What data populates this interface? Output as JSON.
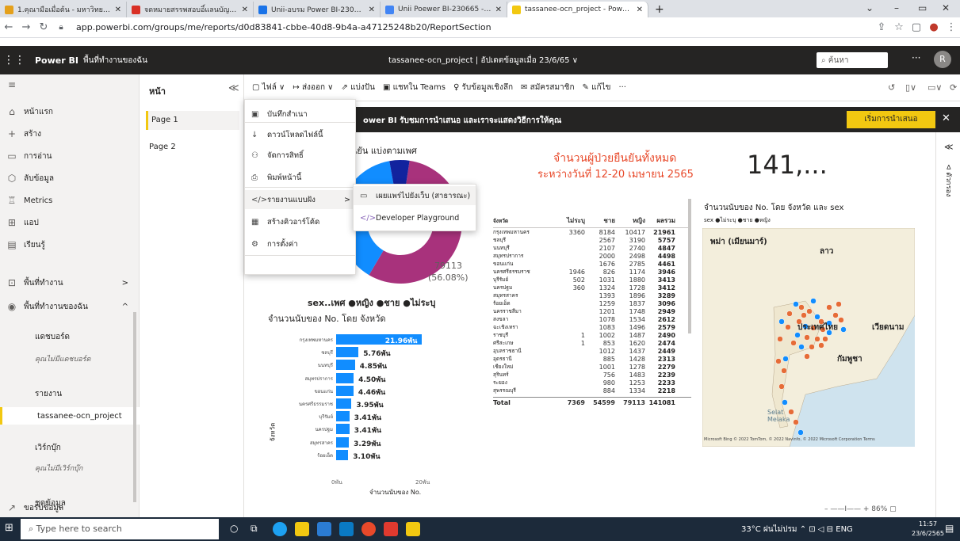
{
  "tabs": [
    {
      "title": "1.คุณามือเมื่อต้น - มหาวิทยาลัยอุบ",
      "color": "#e4a01b"
    },
    {
      "title": "จดหมายสรรพสอบอิ์แลนบัญชี Ubon R",
      "color": "#d93025"
    },
    {
      "title": "Unii-อบรม Power BI-2306665 - G",
      "color": "#1a73e8"
    },
    {
      "title": "Unii Poewer BI-230665 - Google",
      "color": "#4285f4"
    },
    {
      "title": "tassanee-ocn_project - Power BI",
      "color": "#f2c811"
    }
  ],
  "url": "app.powerbi.com/groups/me/reports/d0d83841-cbbe-40d8-9b4a-a47125248b20/ReportSection",
  "header": {
    "app": "Power BI",
    "workspace": "พื้นที่ทำงานของฉัน",
    "report": "tassanee-ocn_project",
    "updated": "อัปเดตข้อมูลเมื่อ 23/6/65",
    "search": "ค้นหา",
    "user_initial": "R"
  },
  "leftnav": [
    {
      "icon": "⌂",
      "label": "หน้าแรก"
    },
    {
      "icon": "+",
      "label": "สร้าง"
    },
    {
      "icon": "▭",
      "label": "การอ่าน"
    },
    {
      "icon": "⬡",
      "label": "ลับข้อมูล"
    },
    {
      "icon": "♖",
      "label": "Metrics"
    },
    {
      "icon": "⊞",
      "label": "แอป"
    },
    {
      "icon": "▤",
      "label": "เรียนรู้"
    },
    {
      "icon": "⊡",
      "label": "พื้นที่ทำงาน"
    },
    {
      "icon": "◉",
      "label": "พื้นที่ทำงานของฉัน"
    }
  ],
  "leftsub": [
    "แดชบอร์ด",
    "คุณไม่มีแดชบอร์ด",
    "รายงาน",
    "tassanee-ocn_project",
    "เวิร์กบุ๊ก",
    "คุณไม่มีเวิร์กบุ๊ก",
    "ชุดข้อมูล"
  ],
  "getdata": "ขอรับข้อมูล",
  "pages_title": "หน้า",
  "pages": [
    "Page 1",
    "Page 2"
  ],
  "toolbar": [
    "ไฟล์ ∨",
    "ส่งออก ∨",
    "แบ่งปัน",
    "แชทใน Teams",
    "รับข้อมูลเชิงลึก",
    "สมัครสมาชิก",
    "แก้ไข",
    "···"
  ],
  "banner": {
    "text": "ower BI  รับชมการนำเสนอ และเราจะแสดงวิธีการให้คุณ",
    "button": "เริ่มการนำเสนอ"
  },
  "menu_file": [
    "บันทึกสำเนา",
    "ดาวน์โหลดไฟล์นี้",
    "จัดการสิทธิ์",
    "พิมพ์หน้านี้",
    "รายงานแบบฝัง",
    "สร้างคิวอาร์โค้ด",
    "การตั้งค่า"
  ],
  "menu_embed": [
    "เผยแพร่ไปยังเว็บ (สาธารณะ)",
    "Developer Playground"
  ],
  "report": {
    "donut_title": "ยยืนยัน แบ่งตามเพศ",
    "donut_label": "79113",
    "donut_pct": "(56.08%)",
    "legend": "sex..เพศ ●หญิง ●ชาย ●ไม่ระบุ",
    "headline_1": "จำนวนผู้ป่วยยืนยันทั้งหมด",
    "headline_2": "ระหว่างวันที่ 12-20 เมษายน 2565",
    "kpi": "141,...",
    "bar_title": "จำนวนนับของ No. โดย จังหวัด",
    "bar_ylabel": "จังหวัด",
    "bar_xlabel": "จำนวนนับของ No.",
    "bar_ticks": [
      "0พัน",
      "20พัน"
    ],
    "map_title": "จำนวนนับของ No. โดย จังหวัด และ sex",
    "map_legend": "sex ●ไม่ระบุ ●ชาย ●หญิง",
    "map_labels": [
      "พม่า (เมียนมาร์)",
      "ลาว",
      "ประเทศไทย",
      "เวียดนาม",
      "กัมพูชา",
      "Selat Melaka"
    ],
    "map_credit": "Microsoft Bing © 2022 TomTom, © 2022 Navinfo, © 2022 Microsoft Corporation  Terms"
  },
  "table": {
    "headers": [
      "จังหวัด",
      "ไม่ระบุ",
      "ชาย",
      "หญิง",
      "ผลรวม"
    ],
    "rows": [
      [
        "กรุงเทพมหานคร",
        "3360",
        "8184",
        "10417",
        "21961"
      ],
      [
        "ชลบุรี",
        "",
        "2567",
        "3190",
        "5757"
      ],
      [
        "นนทบุรี",
        "",
        "2107",
        "2740",
        "4847"
      ],
      [
        "สมุทรปราการ",
        "",
        "2000",
        "2498",
        "4498"
      ],
      [
        "ขอนแก่น",
        "",
        "1676",
        "2785",
        "4461"
      ],
      [
        "นครศรีธรรมราช",
        "1946",
        "826",
        "1174",
        "3946"
      ],
      [
        "บุรีรัมย์",
        "502",
        "1031",
        "1880",
        "3413"
      ],
      [
        "นครปฐม",
        "360",
        "1324",
        "1728",
        "3412"
      ],
      [
        "สมุทรสาคร",
        "",
        "1393",
        "1896",
        "3289"
      ],
      [
        "ร้อยเอ็ด",
        "",
        "1259",
        "1837",
        "3096"
      ],
      [
        "นครราชสีมา",
        "",
        "1201",
        "1748",
        "2949"
      ],
      [
        "สงขลา",
        "",
        "1078",
        "1534",
        "2612"
      ],
      [
        "ฉะเชิงเทรา",
        "",
        "1083",
        "1496",
        "2579"
      ],
      [
        "ราชบุรี",
        "1",
        "1002",
        "1487",
        "2490"
      ],
      [
        "ศรีสะเกษ",
        "1",
        "853",
        "1620",
        "2474"
      ],
      [
        "อุบลราชธานี",
        "",
        "1012",
        "1437",
        "2449"
      ],
      [
        "อุดรธานี",
        "",
        "885",
        "1428",
        "2313"
      ],
      [
        "เชียงใหม่",
        "",
        "1001",
        "1278",
        "2279"
      ],
      [
        "สุรินทร์",
        "",
        "756",
        "1483",
        "2239"
      ],
      [
        "ระยอง",
        "",
        "980",
        "1253",
        "2233"
      ],
      [
        "สุพรรณบุรี",
        "",
        "884",
        "1334",
        "2218"
      ]
    ],
    "total": [
      "Total",
      "7369",
      "54599",
      "79113",
      "141081"
    ]
  },
  "chart_data": {
    "type": "bar",
    "title": "จำนวนนับของ No. โดย จังหวัด",
    "xlabel": "จำนวนนับของ No.",
    "ylabel": "จังหวัด",
    "categories": [
      "กรุงเทพมหานคร",
      "ชลบุรี",
      "นนทบุรี",
      "สมุทรปราการ",
      "ขอนแก่น",
      "นครศรีธรรมราช",
      "บุรีรัมย์",
      "นครปฐม",
      "สมุทรสาคร",
      "ร้อยเอ็ด"
    ],
    "values": [
      21.96,
      5.76,
      4.85,
      4.5,
      4.46,
      3.95,
      3.41,
      3.41,
      3.29,
      3.1
    ],
    "value_labels": [
      "21.96พัน",
      "5.76พัน",
      "4.85พัน",
      "4.50พัน",
      "4.46พัน",
      "3.95พัน",
      "3.41พัน",
      "3.41พัน",
      "3.29พัน",
      "3.10พัน"
    ],
    "xlim": [
      0,
      22
    ],
    "color": "#118dff"
  },
  "donut_data": {
    "values": [
      79113,
      54599,
      7369
    ],
    "labels": [
      "หญิง",
      "ชาย",
      "ไม่ระบุ"
    ],
    "colors": [
      "#a8327c",
      "#118dff",
      "#12239e"
    ]
  },
  "zoom": "86%",
  "taskbar": {
    "search": "Type here to search",
    "weather": "33°C ฝนไม่ปรม",
    "lang": "ENG",
    "time": "11:57",
    "date": "23/6/2565"
  }
}
